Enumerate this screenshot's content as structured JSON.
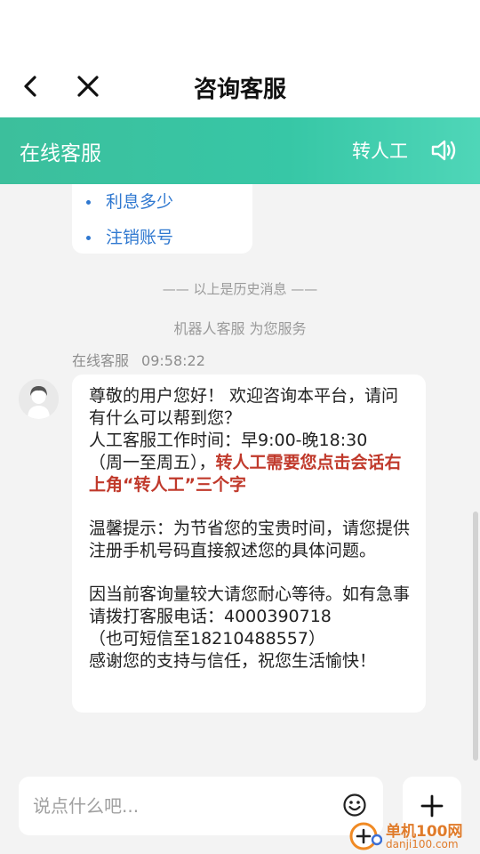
{
  "nav": {
    "title": "咨询客服",
    "back_icon": "back-arrow-icon",
    "close_icon": "close-icon"
  },
  "service_bar": {
    "name": "在线客服",
    "transfer_label": "转人工",
    "speaker_icon": "speaker-icon",
    "gradient_colors": [
      "#3cbf9c",
      "#4fd6b8"
    ]
  },
  "top_card": {
    "items": [
      "利息多少",
      "注销账号"
    ],
    "link_color": "#2f78d0"
  },
  "chat": {
    "history_divider": "—— 以上是历史消息 ——",
    "robot_notice": "机器人客服 为您服务",
    "sender_name": "在线客服",
    "sender_time": "09:58:22"
  },
  "message": {
    "line1": "尊敬的用户您好！ 欢迎咨询本平台，请问有什么可以帮到您？",
    "line2": "人工客服工作时间：早9:00-晚18:30",
    "line3_prefix": "（周一至周五），",
    "line3_highlight": "转人工需要您点击会话右上角“转人工”三个字",
    "tip": "温馨提示：为节省您的宝贵时间，请您提供注册手机号码直接叙述您的具体问题。",
    "notice": "因当前客询量较大请您耐心等待。如有急事请拨打客服电话：4000390718",
    "sms": "（也可短信至18210488557）",
    "thanks": "感谢您的支持与信任，祝您生活愉快！",
    "highlight_color": "#c0392b"
  },
  "input": {
    "placeholder": "说点什么吧...",
    "emoji_icon": "emoji-icon",
    "plus_icon": "plus-icon"
  },
  "watermark": {
    "text": "单机100网",
    "url": "danji100.com"
  }
}
